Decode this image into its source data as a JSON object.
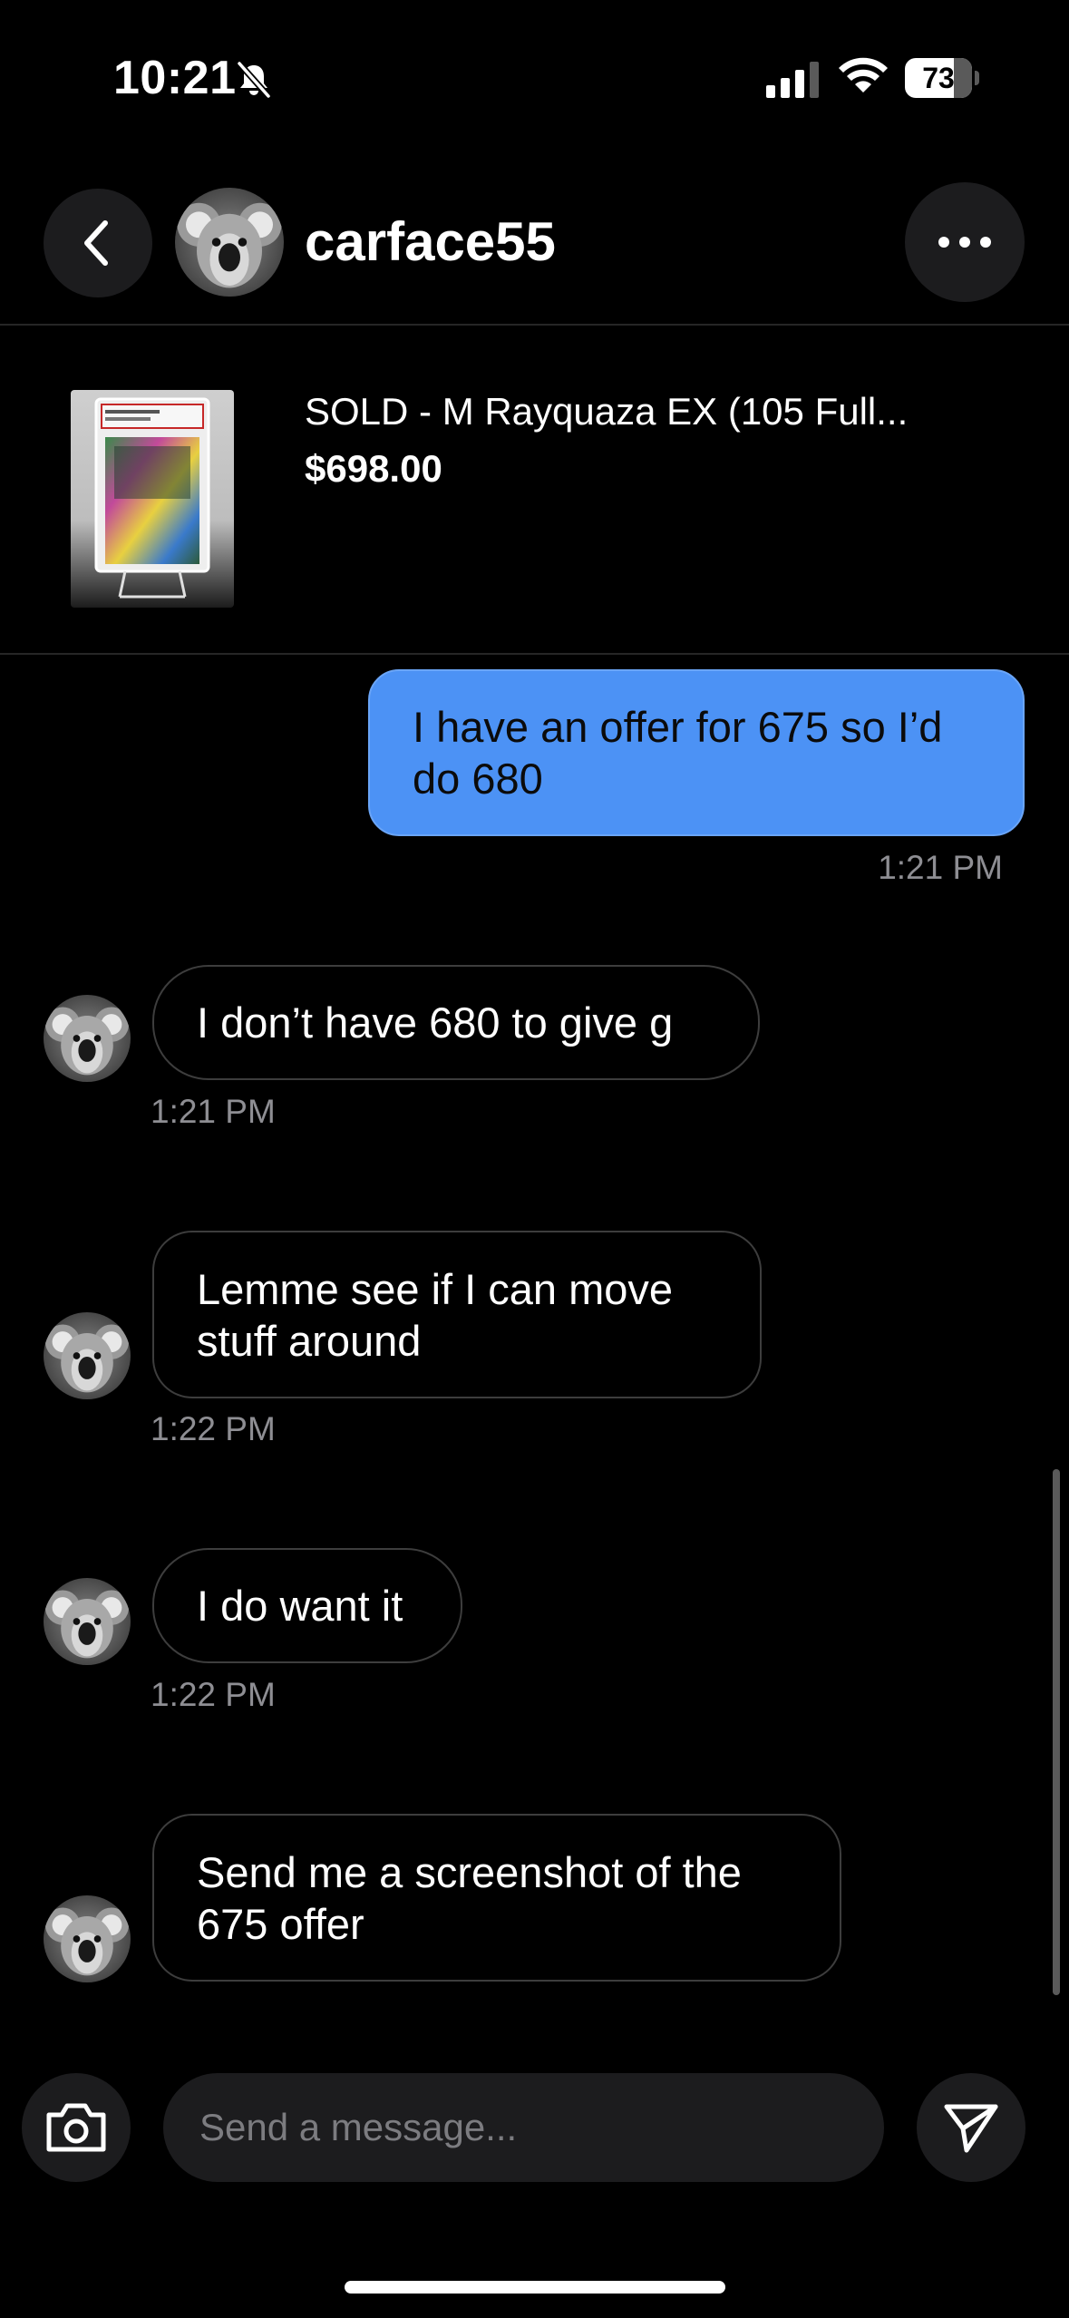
{
  "status_bar": {
    "time": "10:21",
    "battery": 73,
    "icons": [
      "bell-muted-icon",
      "cellular-signal-icon",
      "wifi-icon",
      "battery-icon"
    ]
  },
  "header": {
    "username": "carface55",
    "back_icon": "chevron-left-icon",
    "more_icon": "ellipsis-icon"
  },
  "listing": {
    "title": "SOLD - M Rayquaza EX (105 Full...",
    "price": "$698.00"
  },
  "messages": [
    {
      "direction": "outgoing",
      "text": "I have an offer for 675 so I’d do 680",
      "time": "1:21 PM"
    },
    {
      "direction": "incoming",
      "text": "I don’t have 680 to give g",
      "time": "1:21 PM"
    },
    {
      "direction": "incoming",
      "text": "Lemme see if I can move stuff around",
      "time": "1:22 PM"
    },
    {
      "direction": "incoming",
      "text": "I do want it",
      "time": "1:22 PM"
    },
    {
      "direction": "incoming",
      "text": "Send me a screenshot of the 675 offer"
    }
  ],
  "composer": {
    "placeholder": "Send a message...",
    "camera_icon": "camera-icon",
    "send_icon": "send-icon"
  },
  "colors": {
    "background": "#000000",
    "outgoing_bubble": "#4c92f5",
    "incoming_border": "#3d3d3d",
    "control_background": "#1c1c1e",
    "timestamp": "#8e8e93"
  }
}
